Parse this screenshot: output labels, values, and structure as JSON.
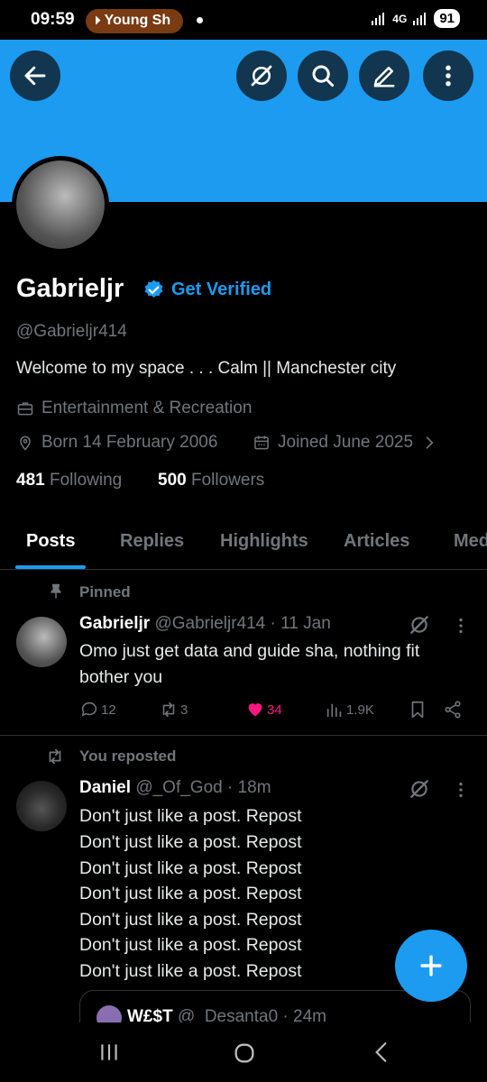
{
  "status_bar": {
    "time": "09:59",
    "media_pill": "Young Sh",
    "network": "4G",
    "battery": "91"
  },
  "header": {
    "back_icon": "arrow-left-icon",
    "grok_icon": "grok-icon",
    "search_icon": "search-icon",
    "edit_icon": "pencil-icon",
    "more_icon": "more-vertical-icon",
    "banner_color": "#1d9bf0"
  },
  "profile": {
    "name": "Gabrieljr",
    "get_verified": "Get Verified",
    "handle": "@Gabrieljr414",
    "bio": "Welcome to my space . . . Calm || Manchester city",
    "category": "Entertainment & Recreation",
    "born": "Born 14 February 2006",
    "joined": "Joined June 2025",
    "following_count": "481",
    "following_label": "Following",
    "followers_count": "500",
    "followers_label": "Followers"
  },
  "tabs": [
    "Posts",
    "Replies",
    "Highlights",
    "Articles",
    "Media"
  ],
  "pinned_post": {
    "pinned_label": "Pinned",
    "author": "Gabrieljr",
    "handle": "@Gabrieljr414",
    "time": "· 11 Jan",
    "text_line1": "Omo just get data and guide sha, nothing fit",
    "text_line2": "bother you",
    "replies": "12",
    "reposts": "3",
    "likes": "34",
    "views": "1.9K"
  },
  "repost": {
    "repost_label": "You reposted",
    "author": "Daniel",
    "handle": "@_Of_God",
    "time": "· 18m",
    "lines": [
      "Don't just like a post. Repost",
      "Don't just like a post. Repost",
      "Don't just like a post. Repost",
      "Don't just like a post. Repost",
      "Don't just like a post. Repost",
      "Don't just like a post. Repost",
      "Don't just like a post. Repost"
    ],
    "quote_author": "W£$T",
    "quote_meta": "@_Desanta0 · 24m"
  },
  "colors": {
    "accent": "#1d9bf0",
    "like": "#f91880",
    "muted": "#71767b"
  }
}
